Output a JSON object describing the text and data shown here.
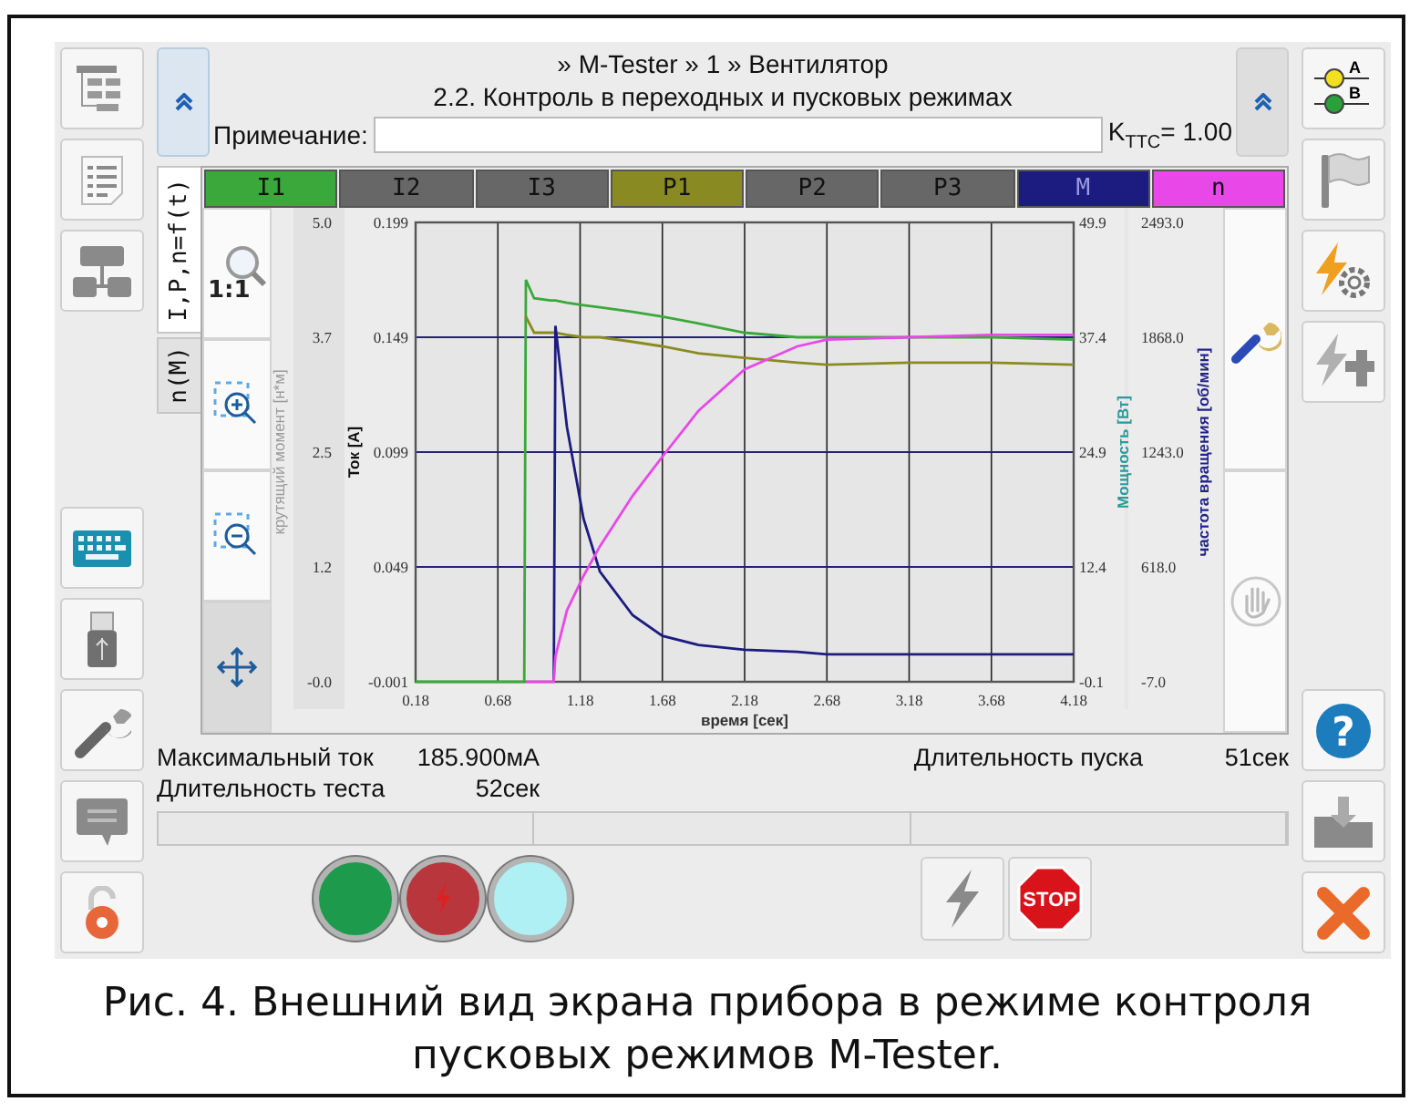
{
  "breadcrumb": "» M-Tester » 1 » Вентилятор",
  "title": "2.2. Контроль в переходных и пусковых режимах",
  "note": {
    "label": "Примечание:"
  },
  "coefficient": "K$_{ТТС}$= 1.00",
  "switch_labels": [
    "A",
    "B"
  ],
  "tabs": [
    {
      "label": "I,P,n=f(t)",
      "selected": true
    },
    {
      "label": "n(M)",
      "selected": false
    }
  ],
  "legend": [
    {
      "kind": "series"
    },
    {
      "kind": "channel",
      "label": "I2",
      "color": "#676767"
    },
    {
      "kind": "channel",
      "label": "I3",
      "color": "#676767"
    },
    {
      "kind": "series"
    },
    {
      "kind": "channel",
      "label": "P2",
      "color": "#676767"
    },
    {
      "kind": "channel",
      "label": "P3",
      "color": "#676767"
    },
    {
      "kind": "series"
    },
    {
      "kind": "series"
    }
  ],
  "zoom_reset": "1:1",
  "axes": [
    {
      "kind": "torque",
      "title": "крутящий момент [н*м]",
      "ticks": [
        "5.0",
        "3.7",
        "2.5",
        "1.2",
        "-0.0"
      ]
    },
    {
      "kind": "power",
      "title": "Мощность [Вт]",
      "ticks": [
        "49.9",
        "37.4",
        "24.9",
        "12.4",
        "-0.1"
      ]
    },
    {
      "kind": "speed",
      "title": "частота вращения [об/мин]",
      "ticks": [
        "2493.0",
        "1868.0",
        "1243.0",
        "618.0",
        "-7.0"
      ]
    }
  ],
  "chart_data": {
    "type": "line",
    "grid": true,
    "xlabel": "время [сек]",
    "ylabel": "Ток [А]",
    "x": [
      0.18,
      0.5,
      0.84,
      0.85,
      0.9,
      1.0,
      1.02,
      1.03,
      1.1,
      1.2,
      1.3,
      1.5,
      1.68,
      1.9,
      2.18,
      2.5,
      2.68,
      3.18,
      3.68,
      4.18
    ],
    "xlim": [
      0.18,
      4.18
    ],
    "ylim": [
      -0.001,
      0.199
    ],
    "xticks": [
      0.18,
      0.68,
      1.18,
      1.68,
      2.18,
      2.68,
      3.18,
      3.68,
      4.18
    ],
    "yticks": [
      {
        "value": 0.199,
        "label": "0.199"
      },
      {
        "value": 0.149,
        "label": "0.149"
      },
      {
        "value": 0.099,
        "label": "0.099"
      },
      {
        "value": 0.049,
        "label": "0.049"
      },
      {
        "value": -0.001,
        "label": "-0.001"
      }
    ],
    "series": [
      {
        "name": "I1",
        "color": "#3aa83a",
        "values": [
          -0.001,
          -0.001,
          -0.001,
          0.174,
          0.166,
          0.165,
          0.165,
          0.165,
          0.164,
          0.163,
          0.162,
          0.16,
          0.158,
          0.155,
          0.151,
          0.149,
          0.149,
          0.149,
          0.149,
          0.148
        ]
      },
      {
        "name": "P1",
        "color": "#8a8a22",
        "values": [
          null,
          null,
          null,
          0.158,
          0.151,
          0.151,
          0.151,
          0.151,
          0.15,
          0.149,
          0.149,
          0.147,
          0.145,
          0.142,
          0.14,
          0.138,
          0.137,
          0.138,
          0.138,
          0.137
        ]
      },
      {
        "name": "M",
        "color": "#1c1c80",
        "values": [
          null,
          null,
          null,
          null,
          null,
          null,
          -0.001,
          0.154,
          0.11,
          0.07,
          0.047,
          0.028,
          0.019,
          0.015,
          0.013,
          0.012,
          0.011,
          0.011,
          0.011,
          0.011
        ]
      },
      {
        "name": "n",
        "color": "#e848e8",
        "values": [
          null,
          null,
          null,
          -0.001,
          -0.001,
          -0.001,
          -0.001,
          0.01,
          0.03,
          0.045,
          0.058,
          0.08,
          0.097,
          0.117,
          0.135,
          0.145,
          0.148,
          0.149,
          0.15,
          0.15
        ]
      }
    ]
  },
  "stats": [
    {
      "label": "Максимальный ток",
      "value": "185.900мА"
    },
    {
      "label": "Длительность теста",
      "value": "52сек"
    },
    {
      "label": "Длительность пуска",
      "value": "51сек"
    }
  ],
  "lamps": [
    {
      "color": "#1d9a4c"
    },
    {
      "color": "#b8363c"
    },
    {
      "color": "#aef0f4"
    }
  ],
  "stop_label": "STOP",
  "help_label": "?",
  "caption": "Рис. 4. Внешний вид экрана прибора в режиме контроля пусковых режимов M-Tester."
}
